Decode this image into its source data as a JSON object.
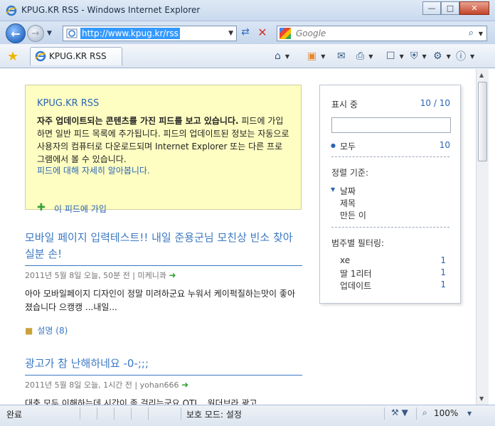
{
  "window": {
    "title": "KPUG.KR RSS - Windows Internet Explorer",
    "minimize": "—",
    "maximize": "□",
    "close": "✕"
  },
  "address_bar": {
    "url": "http://www.kpug.kr/rss",
    "search_placeholder": "Google"
  },
  "tab": {
    "label": "KPUG.KR RSS"
  },
  "feed_info": {
    "title": "KPUG.KR RSS",
    "bold_text": "자주 업데이트되는 콘텐츠를 가진 피드를 보고 있습니다.",
    "body_text": "피드에 가입하면 일반 피드 목록에 추가됩니다. 피드의 업데이트된 정보는 자동으로 사용자의 컴퓨터로 다운로드되며 Internet Explorer 또는 다른 프로그램에서 볼 수 있습니다.",
    "learn_more": "피드에 대해 자세히 알아봅니다.",
    "subscribe": "이 피드에 가입"
  },
  "posts": [
    {
      "title": "모바일 페이지 입력테스트!! 내일 준용군님 모친상 빈소 찾아실분 손!",
      "meta": "2011년 5월 8일 오늘, 50분 전 | 미케니콰",
      "body": "아아 모바일페이지 디자인이 정말 미려하군요 누워서 케이퍽질하는맛이 좋아졌습니다 으캥캥 ...내일...",
      "comment": "설명",
      "comment_count": "(8)"
    },
    {
      "title": "광고가 참 난해하네요 -0-;;;",
      "meta": "2011년 5월 8일 오늘, 1시간 전 | yohan666",
      "body": "대충 모두 이해하는데 시간이 좀 걸리는군요 OTL.. 원더브라 광고"
    }
  ],
  "filter": {
    "showing_label": "표시 중",
    "showing_count": "10 / 10",
    "all_label": "모두",
    "all_count": "10",
    "sort_label": "정렬 기준:",
    "sort_date": "날짜",
    "sort_title": "제목",
    "sort_author": "만든 이",
    "category_label": "범주별 필터링:",
    "categories": [
      {
        "name": "xe",
        "count": "1"
      },
      {
        "name": "딸 1리터",
        "count": "1"
      },
      {
        "name": "업데이트",
        "count": "1"
      }
    ]
  },
  "status_bar": {
    "done": "완료",
    "protected_mode": "보호 모드: 설정",
    "zoom": "100%"
  }
}
